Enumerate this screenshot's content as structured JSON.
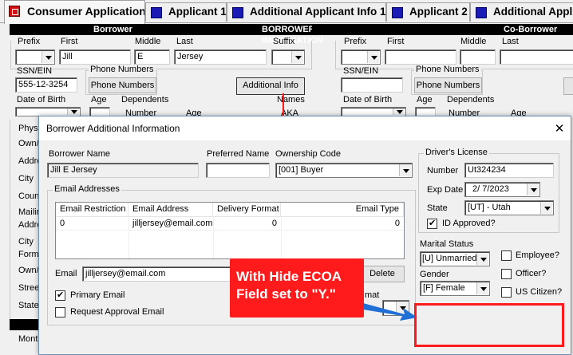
{
  "tabs": [
    {
      "label": "Consumer Application"
    },
    {
      "label": "Applicant 1"
    },
    {
      "label": "Additional Applicant Info 1"
    },
    {
      "label": "Applicant 2"
    },
    {
      "label": "Additional Appli"
    }
  ],
  "headers": {
    "borrower": "Borrower",
    "main": "BORROWER INFORMATION",
    "coborrower": "Co-Borrower"
  },
  "borrower": {
    "prefix_label": "Prefix",
    "first_label": "First",
    "middle_label": "Middle",
    "last_label": "Last",
    "suffix_label": "Suffix",
    "first": "Jill",
    "middle": "E",
    "last": "Jersey",
    "ssn_label": "SSN/EIN",
    "ssn": "555-12-3254",
    "phone_group": "Phone Numbers",
    "phone_button": "Phone Numbers",
    "additional_info_button": "Additional Info",
    "dob_label": "Date of Birth",
    "age_label": "Age",
    "dependents_label": "Dependents",
    "names_label": "Names",
    "number_label": "Number",
    "age2_label": "Age",
    "aka_label": "AKA",
    "side_labels": [
      "Physi",
      "Own/",
      "Addre",
      "City",
      "Coun",
      "Mailin",
      "Addre",
      "City",
      "Forme",
      "Own/",
      "Stree",
      "State",
      "Month"
    ]
  },
  "coborrower": {
    "prefix_label": "Prefix",
    "first_label": "First",
    "middle_label": "Middle",
    "last_label": "Last",
    "ssn_label": "SSN/EIN",
    "phone_group": "Phone Numbers",
    "phone_button": "Phone Numbers",
    "dob_label": "Date of Birth",
    "age_label": "Age",
    "dependents_label": "Dependents",
    "number_label": "Number",
    "age2_label": "Age"
  },
  "dialog": {
    "title": "Borrower Additional Information",
    "close_glyph": "✕",
    "borrower_name_label": "Borrower Name",
    "borrower_name": "Jill E Jersey",
    "preferred_name_label": "Preferred Name",
    "preferred_name": "",
    "ownership_label": "Ownership Code",
    "ownership": "[001] Buyer",
    "email_group": "Email Addresses",
    "email_columns": [
      "Email Restriction",
      "Email Address",
      "Delivery Format",
      "Email Type"
    ],
    "email_rows": [
      {
        "restriction": "0",
        "address": "jilljersey@email.com",
        "delivery": "0",
        "type": "0"
      }
    ],
    "email_label": "Email",
    "email_value": "jilljersey@email.com",
    "delete_button": "Delete",
    "format_label": "mat",
    "primary_email_label": "Primary Email",
    "primary_email_checked": true,
    "request_approval_label": "Request Approval Email",
    "request_approval_checked": false,
    "license_group": "Driver's License",
    "license_number_label": "Number",
    "license_number": "Ut324234",
    "exp_date_label": "Exp Date",
    "exp_date": "2/ 7/2023",
    "state_label": "State",
    "state": "[UT] - Utah",
    "id_approved_label": "ID Approved?",
    "id_approved_checked": true,
    "marital_label": "Marital Status",
    "marital": "[U] Unmarried",
    "gender_label": "Gender",
    "gender": "[F] Female",
    "employee_label": "Employee?",
    "officer_label": "Officer?",
    "citizen_label": "US Citizen?"
  },
  "annotation": {
    "callout": "With Hide ECOA\nField set to \"Y.\"",
    "line1": "With Hide ECOA",
    "line2": "Field set to \"Y.\""
  },
  "colors": {
    "callout_red": "#ff1b1b",
    "tab_icon_blue": "#1a1ab4",
    "active_tab_icon": "#d01010"
  }
}
